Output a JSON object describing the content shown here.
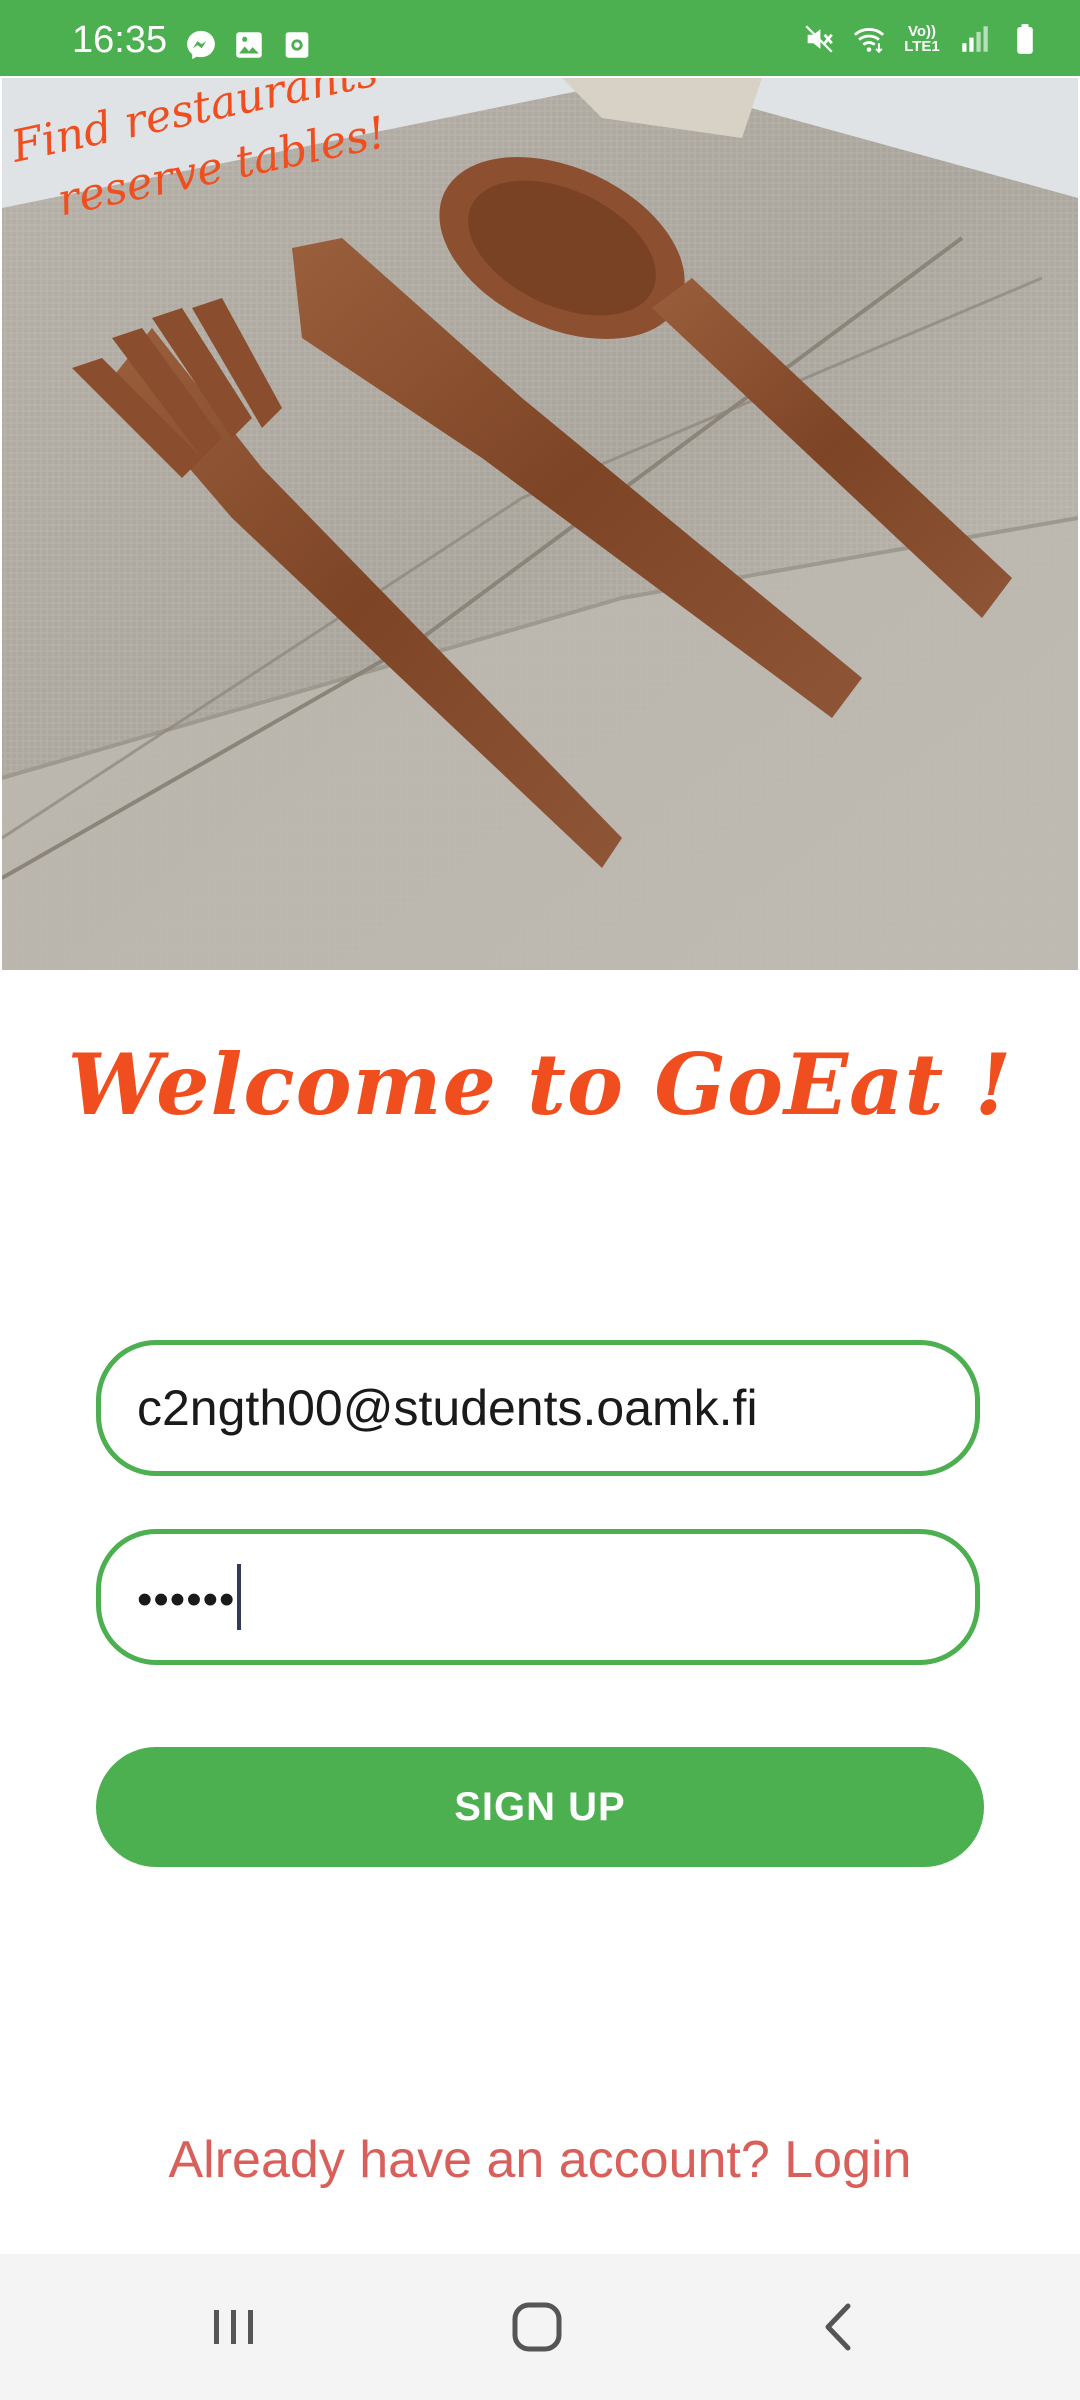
{
  "status_bar": {
    "time": "16:35",
    "notification_icons": [
      "messenger-icon",
      "gallery-icon",
      "screen-recorder-icon"
    ],
    "system_icons": [
      "mute-icon",
      "wifi-icon",
      "volte-icon",
      "signal-icon",
      "battery-icon"
    ],
    "volte_line1": "Vo))",
    "volte_line2": "LTE1",
    "background_color": "#4caf50"
  },
  "hero": {
    "caption_line1": "Find restaurants",
    "caption_line2": "reserve tables!",
    "image_subject": "wooden fork, knife and spoon on linen cloth"
  },
  "welcome": {
    "title": "Welcome to GoEat !"
  },
  "form": {
    "email_value": "c2ngth00@students.oamk.fi",
    "password_masked": "••••••",
    "signup_label": "SIGN UP"
  },
  "footer": {
    "login_prompt": "Already have an account? Login"
  },
  "nav_bar": {
    "buttons": [
      "recent-apps-icon",
      "home-icon",
      "back-icon"
    ]
  },
  "colors": {
    "accent": "#4caf50",
    "heading": "#f04e1e",
    "link": "#d9605a"
  }
}
